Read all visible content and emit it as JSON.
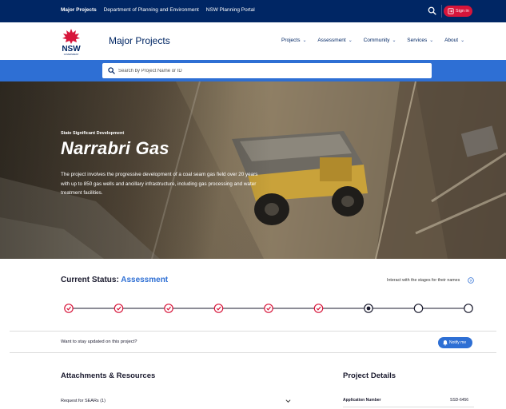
{
  "topbar": {
    "links": [
      "Major Projects",
      "Department of Planning and Environment",
      "NSW Planning Portal"
    ],
    "signin_label": "Sign in",
    "icons": {
      "search": "search-icon",
      "signin": "login-icon"
    }
  },
  "header": {
    "logo_text": "NSW",
    "logo_subtext": "GOVERNMENT",
    "brand": "Major Projects",
    "nav": [
      "Projects",
      "Assessment",
      "Community",
      "Services",
      "About"
    ]
  },
  "search": {
    "placeholder": "Search by Project Name or ID"
  },
  "hero": {
    "kicker": "State Significant Development",
    "title": "Narrabri Gas",
    "description": "The project involves the progressive development of a coal seam gas field over 20 years with up to 850 gas wells and ancillary infrastructure, including gas processing and water treatment facilities."
  },
  "status": {
    "label": "Current Status:",
    "value": "Assessment",
    "hint": "Interact with the stages for their names",
    "stages": [
      "complete",
      "complete",
      "complete",
      "complete",
      "complete",
      "complete",
      "current",
      "pending",
      "pending"
    ]
  },
  "updates": {
    "text": "Want to stay updated on this project?",
    "button_label": "Notify me"
  },
  "attachments": {
    "title": "Attachments & Resources",
    "items": [
      "Request for SEARs (1)"
    ]
  },
  "details": {
    "title": "Project Details",
    "rows": [
      {
        "label": "Application Number",
        "value": "SSD-6456"
      }
    ]
  },
  "colors": {
    "navy": "#002664",
    "blue": "#2e6fd4",
    "red": "#d7153a"
  }
}
